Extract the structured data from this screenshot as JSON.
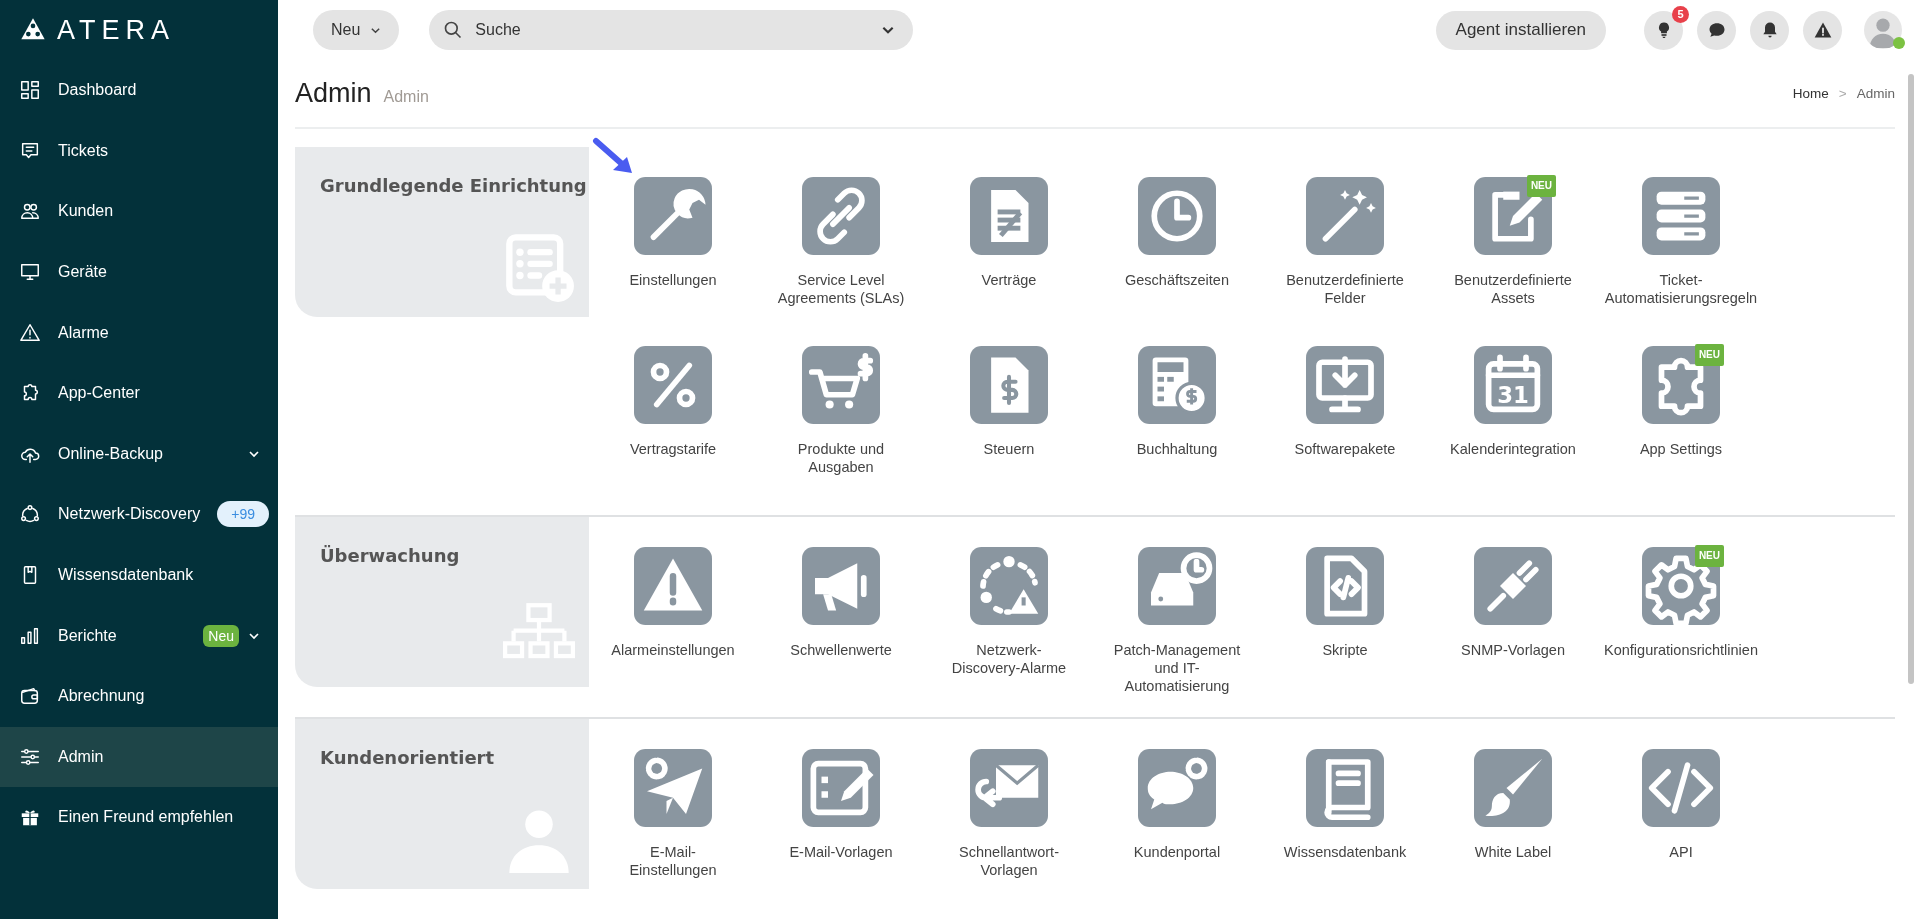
{
  "sidebar": {
    "logo": "ATERA",
    "items": [
      {
        "label": "Dashboard",
        "selected": false
      },
      {
        "label": "Tickets",
        "selected": false
      },
      {
        "label": "Kunden",
        "selected": false
      },
      {
        "label": "Geräte",
        "selected": false
      },
      {
        "label": "Alarme",
        "selected": false
      },
      {
        "label": "App-Center",
        "selected": false
      },
      {
        "label": "Online-Backup",
        "selected": false,
        "expanded": false
      },
      {
        "label": "Netzwerk-Discovery",
        "selected": false,
        "badge": {
          "text": "+99",
          "kind": "count"
        }
      },
      {
        "label": "Wissensdatenbank",
        "selected": false
      },
      {
        "label": "Berichte",
        "selected": false,
        "badge": {
          "text": "Neu",
          "kind": "new"
        },
        "expanded": false
      },
      {
        "label": "Abrechnung",
        "selected": false
      },
      {
        "label": "Admin",
        "selected": true
      },
      {
        "label": "Einen Freund empfehlen",
        "selected": false
      }
    ]
  },
  "topbar": {
    "new_button": "Neu",
    "search": {
      "placeholder": "Suche"
    },
    "agent_button": "Agent installieren",
    "tips_count": "5",
    "user_online": true
  },
  "header": {
    "title": "Admin",
    "subtitle": "Admin",
    "breadcrumb": {
      "items": [
        "Home",
        "Admin"
      ],
      "separator": ">"
    }
  },
  "sections": [
    {
      "title": "Grundlegende Einrichtung",
      "items": [
        {
          "label": "Einstellungen",
          "pointer": true
        },
        {
          "label": "Service Level Agreements (SLAs)"
        },
        {
          "label": "Verträge"
        },
        {
          "label": "Geschäftszeiten"
        },
        {
          "label": "Benutzerdefinierte Felder"
        },
        {
          "label": "Benutzerdefinierte Assets",
          "badge": "NEU"
        },
        {
          "label": "Ticket-Automatisierungsregeln"
        },
        {
          "label": "Vertragstarife"
        },
        {
          "label": "Produkte und Ausgaben"
        },
        {
          "label": "Steuern"
        },
        {
          "label": "Buchhaltung"
        },
        {
          "label": "Softwarepakete"
        },
        {
          "label": "Kalenderintegration",
          "icon_text": "31"
        },
        {
          "label": "App Settings",
          "badge": "NEU"
        }
      ]
    },
    {
      "title": "Überwachung",
      "items": [
        {
          "label": "Alarmeinstellungen"
        },
        {
          "label": "Schwellenwerte"
        },
        {
          "label": "Netzwerk-Discovery-Alarme"
        },
        {
          "label": "Patch-Management und IT-Automatisierung"
        },
        {
          "label": "Skripte"
        },
        {
          "label": "SNMP-Vorlagen"
        },
        {
          "label": "Konfigurationsrichtlinien",
          "badge": "NEU"
        }
      ]
    },
    {
      "title": "Kundenorientiert",
      "items": [
        {
          "label": "E-Mail-Einstellungen"
        },
        {
          "label": "E-Mail-Vorlagen"
        },
        {
          "label": "Schnellantwort-Vorlagen"
        },
        {
          "label": "Kundenportal"
        },
        {
          "label": "Wissensdatenbank"
        },
        {
          "label": "White Label"
        },
        {
          "label": "API"
        }
      ]
    }
  ]
}
